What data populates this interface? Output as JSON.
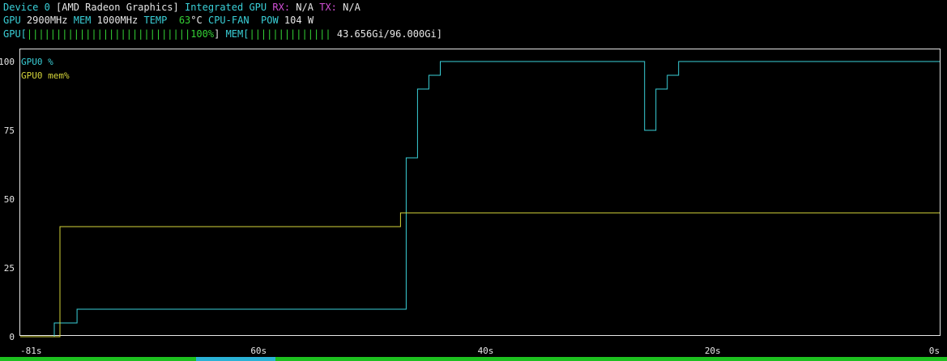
{
  "header": {
    "device_label": "Device 0",
    "device_name": "[AMD Radeon Graphics]",
    "device_type": "Integrated GPU",
    "rx_label": "RX:",
    "rx_value": "N/A",
    "tx_label": "TX:",
    "tx_value": "N/A",
    "gpu_label": "GPU",
    "gpu_clock": "2900MHz",
    "mem_label": "MEM",
    "mem_clock": "1000MHz",
    "temp_label": "TEMP",
    "temp_value": "63",
    "temp_unit": "°C",
    "fan_label": "CPU-FAN",
    "pow_label": "POW",
    "pow_value": "104 W",
    "gpu_bar_label": "GPU[",
    "gpu_bar_fill": "||||||||||||||||||||||||||||",
    "gpu_bar_value": "100%",
    "gpu_bar_close": "]",
    "mem_bar_label": "MEM[",
    "mem_bar_fill": "||||||||||||||",
    "mem_bar_value": " 43.656Gi/96.000Gi",
    "mem_bar_close": "]"
  },
  "colors": {
    "gpu_line": "#3ad0d8",
    "mem_line": "#d4d43a",
    "axis": "#e6e6e6",
    "accent_green": "#34d035",
    "accent_cyan": "#3ad0d8",
    "accent_magenta": "#d24fd6"
  },
  "chart_data": {
    "type": "line",
    "x_unit": "seconds ago",
    "xlim": [
      81,
      0
    ],
    "ylim": [
      0,
      100
    ],
    "x_ticks": [
      {
        "value": 81,
        "label": "81s"
      },
      {
        "value": 60,
        "label": "60s"
      },
      {
        "value": 40,
        "label": "40s"
      },
      {
        "value": 20,
        "label": "20s"
      },
      {
        "value": 0,
        "label": "0s"
      }
    ],
    "y_ticks": [
      {
        "value": 100,
        "label": "100"
      },
      {
        "value": 75,
        "label": "75"
      },
      {
        "value": 50,
        "label": "50"
      },
      {
        "value": 25,
        "label": "25"
      },
      {
        "value": 0,
        "label": "0"
      }
    ],
    "legend_position": "top-left",
    "series": [
      {
        "name": "GPU0 %",
        "color": "#3ad0d8",
        "step": true,
        "points": [
          [
            81,
            0
          ],
          [
            78,
            5
          ],
          [
            76,
            10
          ],
          [
            47,
            65
          ],
          [
            46,
            90
          ],
          [
            45,
            95
          ],
          [
            44,
            100
          ],
          [
            26,
            75
          ],
          [
            25,
            90
          ],
          [
            24,
            95
          ],
          [
            23,
            100
          ],
          [
            0,
            100
          ]
        ]
      },
      {
        "name": "GPU0 mem%",
        "color": "#d4d43a",
        "step": true,
        "points": [
          [
            81,
            0
          ],
          [
            77.5,
            40
          ],
          [
            47.5,
            45
          ],
          [
            0,
            45
          ]
        ]
      }
    ]
  }
}
